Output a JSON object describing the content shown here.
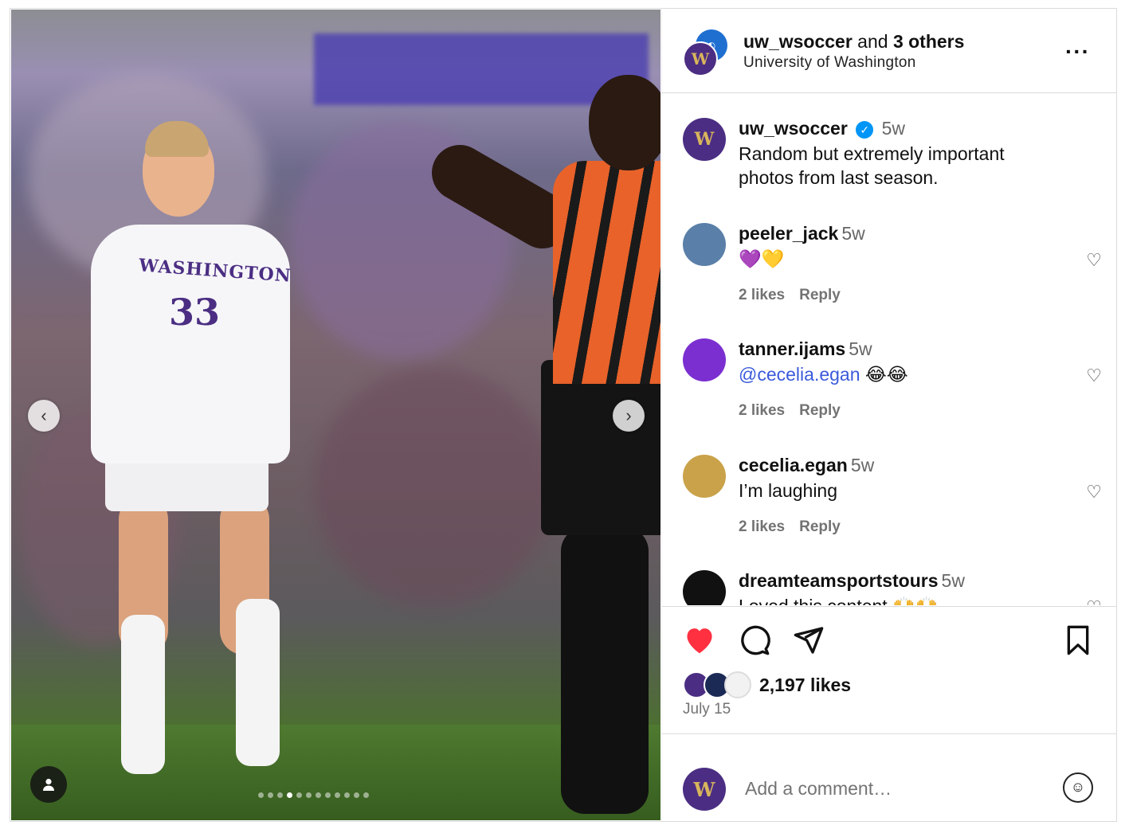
{
  "post": {
    "image_alt": "Washington soccer player #33 talking to a referee",
    "jersey_text": "WASHINGTON",
    "jersey_number": "33",
    "carousel": {
      "total": 12,
      "active": 4
    }
  },
  "header": {
    "author": "uw_wsoccer",
    "collab_joiner": " and ",
    "collab_others": "3 others",
    "location": "University of Washington",
    "more_icon": "more-horizontal-icon"
  },
  "caption": {
    "user": "uw_wsoccer",
    "verified": true,
    "time": "5w",
    "text": "Random but extremely important photos from last season."
  },
  "comments": [
    {
      "user": "peeler_jack",
      "time": "5w",
      "text": "💜💛",
      "likes": "2 likes",
      "reply": "Reply",
      "avatar_color": "#5a7fa8"
    },
    {
      "user": "tanner.ijams",
      "time": "5w",
      "mention": "@cecelia.egan",
      "text": " 😂😂",
      "likes": "2 likes",
      "reply": "Reply",
      "avatar_color": "#7b2fd0"
    },
    {
      "user": "cecelia.egan",
      "time": "5w",
      "text": "I’m laughing",
      "likes": "2 likes",
      "reply": "Reply",
      "avatar_color": "#c9a24a"
    },
    {
      "user": "dreamteamsportstours",
      "time": "5w",
      "text": "Loved this content 🙌🙌",
      "avatar_color": "#111111"
    }
  ],
  "actions": {
    "liked": true,
    "like_color": "#ff3040",
    "likes": "2,197 likes",
    "date": "July 15"
  },
  "composer": {
    "placeholder": "Add a comment…"
  },
  "colors": {
    "uw_purple": "#4b2e83",
    "uw_gold": "#d8b55c",
    "link": "#3b5bdb"
  }
}
